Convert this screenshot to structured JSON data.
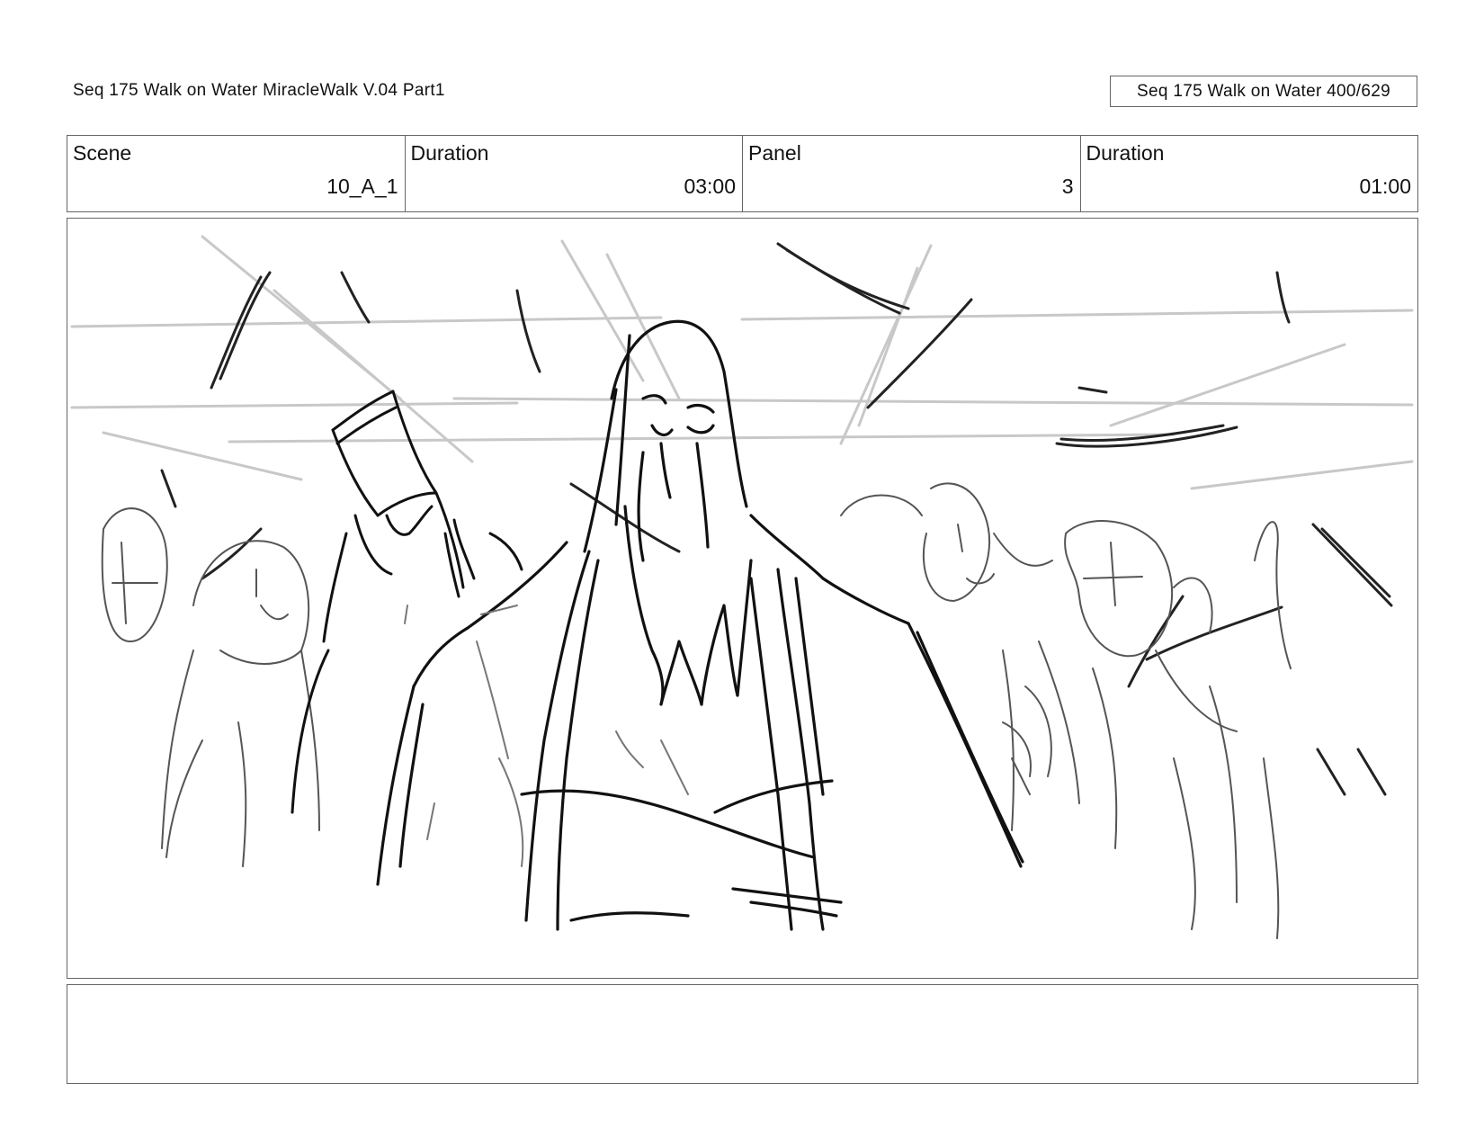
{
  "header": {
    "title": "Seq 175 Walk on Water  MiracleWalk V.04 Part1",
    "page_badge": "Seq 175 Walk on Water 400/629"
  },
  "info": {
    "scene_label": "Scene",
    "scene_value": "10_A_1",
    "duration_label": "Duration",
    "duration_value": "03:00",
    "panel_label": "Panel",
    "panel_value": "3",
    "panel_duration_label": "Duration",
    "panel_duration_value": "01:00"
  },
  "panel": {
    "image": "storyboard-sketch"
  },
  "notes": {
    "text": ""
  }
}
